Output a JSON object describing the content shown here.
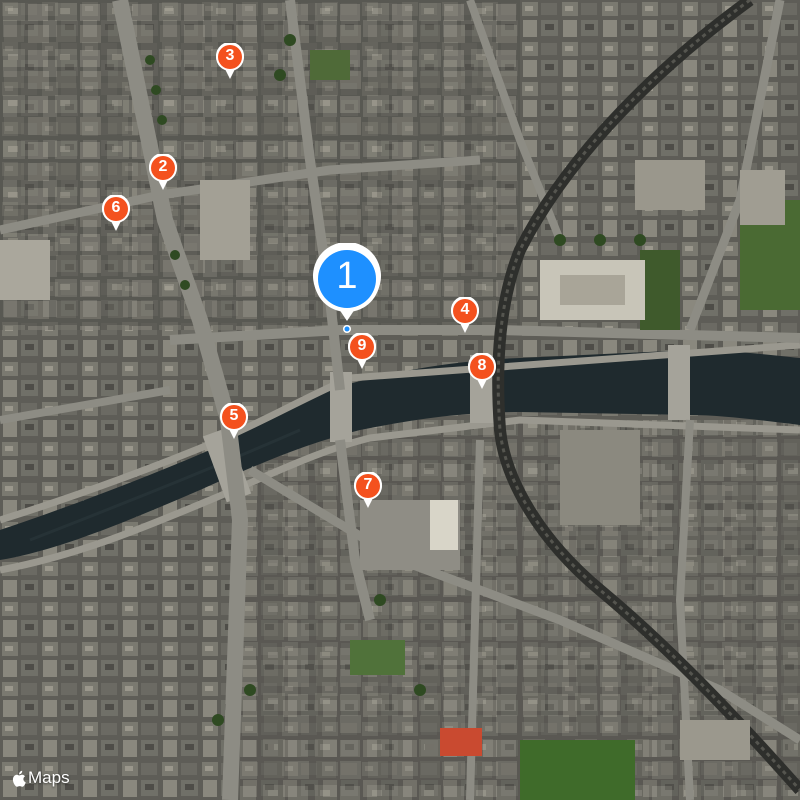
{
  "map": {
    "style": "satellite",
    "attribution": "Maps",
    "attribution_icon": "apple-logo-icon"
  },
  "pins": [
    {
      "id": "1",
      "label": "1",
      "kind": "primary",
      "color": "#1e90ff"
    },
    {
      "id": "2",
      "label": "2",
      "kind": "secondary",
      "color": "#f4511e"
    },
    {
      "id": "3",
      "label": "3",
      "kind": "secondary",
      "color": "#f4511e"
    },
    {
      "id": "4",
      "label": "4",
      "kind": "secondary",
      "color": "#f4511e"
    },
    {
      "id": "5",
      "label": "5",
      "kind": "secondary",
      "color": "#f4511e"
    },
    {
      "id": "6",
      "label": "6",
      "kind": "secondary",
      "color": "#f4511e"
    },
    {
      "id": "7",
      "label": "7",
      "kind": "secondary",
      "color": "#f4511e"
    },
    {
      "id": "8",
      "label": "8",
      "kind": "secondary",
      "color": "#f4511e"
    },
    {
      "id": "9",
      "label": "9",
      "kind": "secondary",
      "color": "#f4511e"
    }
  ],
  "colors": {
    "river": "#1f2a2e",
    "park": "#3f5a2c",
    "road": "#8d8c84",
    "building": "#6a6a64",
    "rail": "#2e2f2c"
  }
}
